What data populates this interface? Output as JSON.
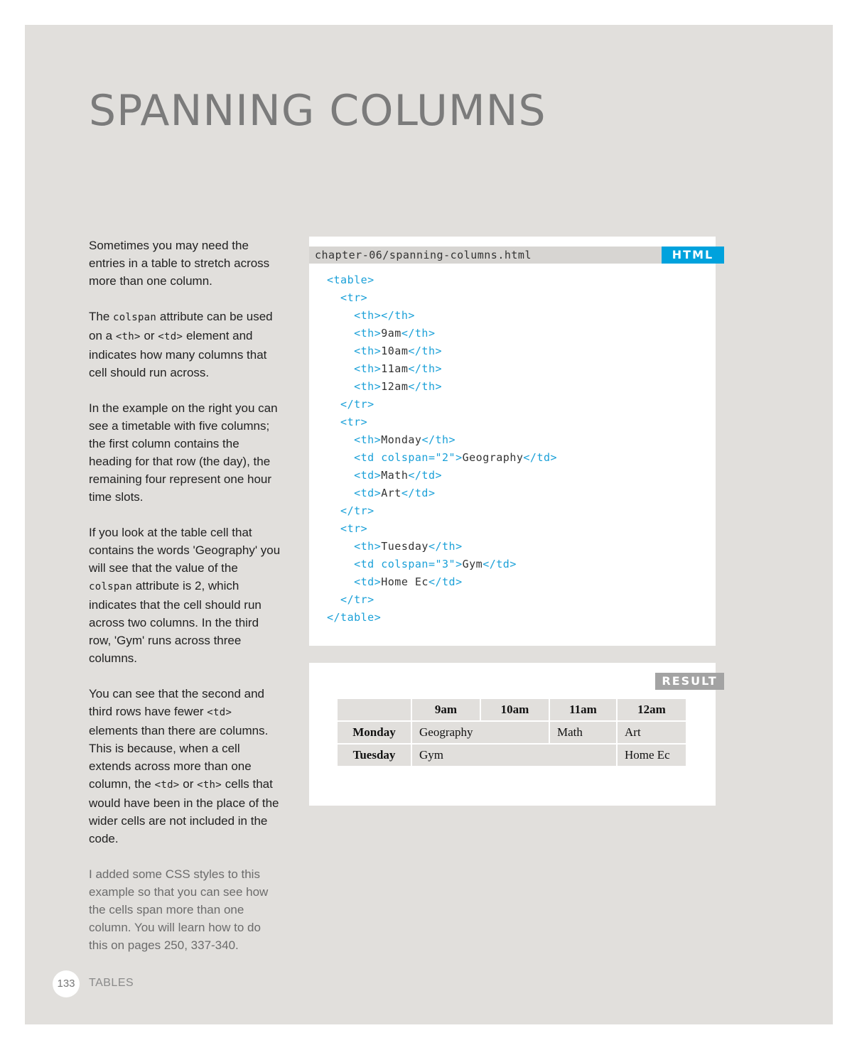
{
  "page": {
    "title": "SPANNING COLUMNS",
    "page_number": "133",
    "section": "TABLES"
  },
  "body": {
    "p1": "Sometimes you may need the entries in a table to stretch across more than one column.",
    "p2": {
      "a": "The ",
      "b": "colspan",
      "c": " attribute can be used on a ",
      "d": "<th>",
      "e": " or ",
      "f": "<td>",
      "g": " element and indicates how many columns that cell should run across."
    },
    "p3": "In the example on the right you can see a timetable with five columns; the first column contains the heading for that row (the day), the remaining four represent one hour time slots.",
    "p4": {
      "a": "If you look at the table cell that contains the words 'Geography' you will see that the value of the ",
      "b": "colspan",
      "c": " attribute is ",
      "d": "2",
      "e": ", which indicates that the cell should run across two columns. In the third row, 'Gym' runs across three columns."
    },
    "p5": {
      "a": "You can see that the second and third rows have fewer ",
      "b": "<td>",
      "c": " elements than there are columns. This is because, when a cell extends across more than one column, the ",
      "d": "<td>",
      "e": " or ",
      "f": "<th>",
      "g": " cells that would have been in the place of the wider cells are not included in the code."
    },
    "note": "I added some CSS styles to this example so that you can see how the cells span more than one column. You will learn how to do this on pages 250, 337-340."
  },
  "code": {
    "filename": "chapter-06/spanning-columns.html",
    "badge": "HTML",
    "lines": [
      [
        [
          "t",
          "<table>"
        ]
      ],
      [
        [
          "t",
          "  <tr>"
        ]
      ],
      [
        [
          "t",
          "    <th></th>"
        ]
      ],
      [
        [
          "t",
          "    <th>"
        ],
        [
          "c",
          "9am"
        ],
        [
          "t",
          "</th>"
        ]
      ],
      [
        [
          "t",
          "    <th>"
        ],
        [
          "c",
          "10am"
        ],
        [
          "t",
          "</th>"
        ]
      ],
      [
        [
          "t",
          "    <th>"
        ],
        [
          "c",
          "11am"
        ],
        [
          "t",
          "</th>"
        ]
      ],
      [
        [
          "t",
          "    <th>"
        ],
        [
          "c",
          "12am"
        ],
        [
          "t",
          "</th>"
        ]
      ],
      [
        [
          "t",
          "  </tr>"
        ]
      ],
      [
        [
          "t",
          "  <tr>"
        ]
      ],
      [
        [
          "t",
          "    <th>"
        ],
        [
          "c",
          "Monday"
        ],
        [
          "t",
          "</th>"
        ]
      ],
      [
        [
          "t",
          "    <td colspan=\"2\">"
        ],
        [
          "c",
          "Geography"
        ],
        [
          "t",
          "</td>"
        ]
      ],
      [
        [
          "t",
          "    <td>"
        ],
        [
          "c",
          "Math"
        ],
        [
          "t",
          "</td>"
        ]
      ],
      [
        [
          "t",
          "    <td>"
        ],
        [
          "c",
          "Art"
        ],
        [
          "t",
          "</td>"
        ]
      ],
      [
        [
          "t",
          "  </tr>"
        ]
      ],
      [
        [
          "t",
          "  <tr>"
        ]
      ],
      [
        [
          "t",
          "    <th>"
        ],
        [
          "c",
          "Tuesday"
        ],
        [
          "t",
          "</th>"
        ]
      ],
      [
        [
          "t",
          "    <td colspan=\"3\">"
        ],
        [
          "c",
          "Gym"
        ],
        [
          "t",
          "</td>"
        ]
      ],
      [
        [
          "t",
          "    <td>"
        ],
        [
          "c",
          "Home Ec"
        ],
        [
          "t",
          "</td>"
        ]
      ],
      [
        [
          "t",
          "  </tr>"
        ]
      ],
      [
        [
          "t",
          "</table>"
        ]
      ]
    ]
  },
  "result": {
    "badge": "RESULT",
    "header": [
      "",
      "9am",
      "10am",
      "11am",
      "12am"
    ],
    "rows": [
      {
        "day": "Monday",
        "cells": [
          {
            "text": "Geography",
            "span": 2
          },
          {
            "text": "Math",
            "span": 1
          },
          {
            "text": "Art",
            "span": 1
          }
        ]
      },
      {
        "day": "Tuesday",
        "cells": [
          {
            "text": "Gym",
            "span": 3
          },
          {
            "text": "Home Ec",
            "span": 1
          }
        ]
      }
    ]
  },
  "colors": {
    "page_bg": "#e1dfdc",
    "code_tag": "#1aa0d8",
    "html_badge": "#00a2dd",
    "result_badge": "#a3a3a3",
    "title": "#7b7b7b"
  }
}
